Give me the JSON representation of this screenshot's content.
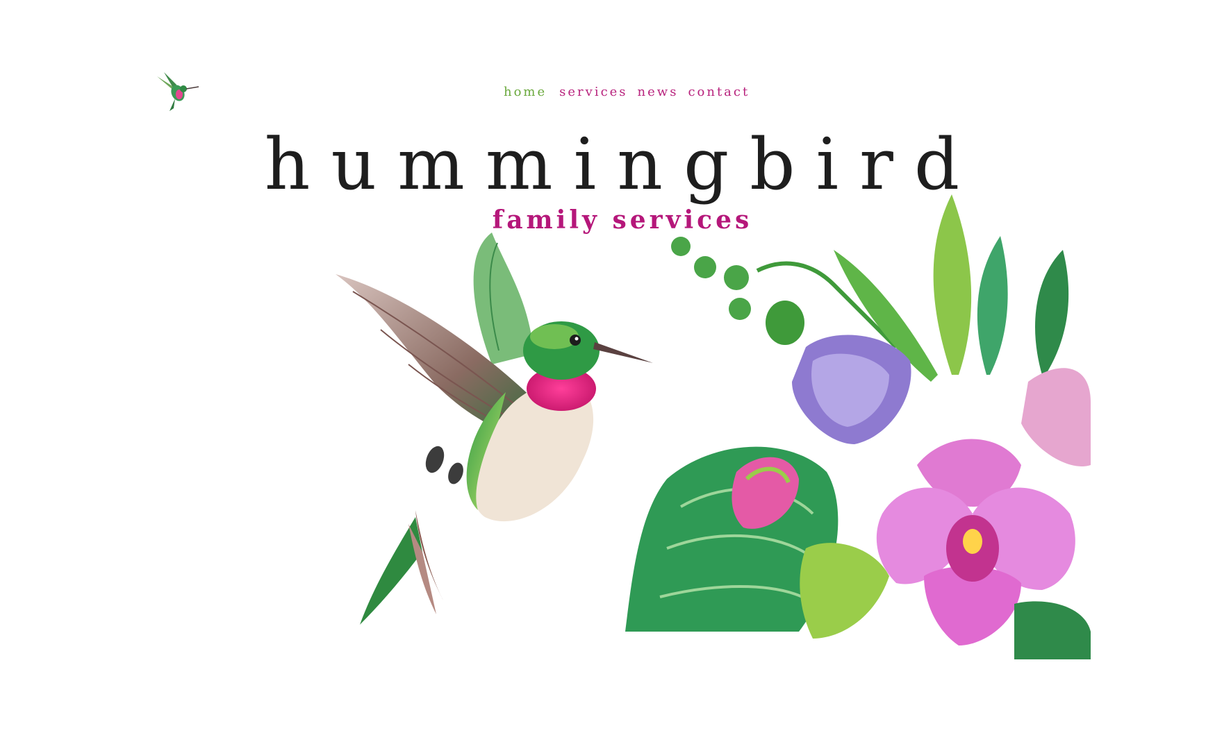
{
  "nav": {
    "home": "home",
    "services": "services",
    "news": "news",
    "contact": "contact"
  },
  "brand": {
    "title": "hummingbird",
    "tagline": "family services"
  },
  "colors": {
    "nav_active": "#6aa83c",
    "accent": "#b5177a",
    "title": "#1e1e1e"
  },
  "icons": {
    "logo": "hummingbird-logo-icon"
  }
}
